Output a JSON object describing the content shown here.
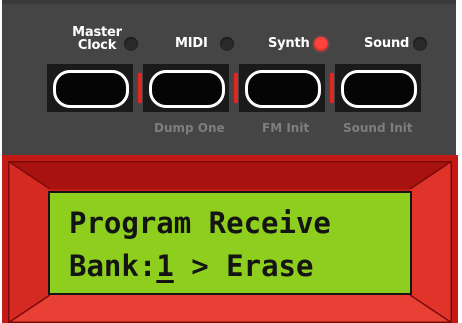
{
  "buttons": [
    {
      "label_line1": "Master",
      "label_line2": "Clock",
      "led_on": false,
      "sub_label": ""
    },
    {
      "label_line1": "MIDI",
      "label_line2": "",
      "led_on": false,
      "sub_label": "Dump One"
    },
    {
      "label_line1": "Synth",
      "label_line2": "",
      "led_on": true,
      "sub_label": "FM Init"
    },
    {
      "label_line1": "Sound",
      "label_line2": "",
      "led_on": false,
      "sub_label": "Sound Init"
    }
  ],
  "display": {
    "line1": "Program Receive",
    "line2_prefix": "Bank:",
    "line2_cursor": "1",
    "line2_suffix": " > Erase"
  },
  "colors": {
    "panel": "#454545",
    "led_on": "#ff4440",
    "led_off": "#2a2a2a",
    "divider_red": "#e3241f",
    "bezel_red": "#c41a15",
    "lcd_green": "#8ece1e",
    "lcd_text": "#141414",
    "sub_label_gray": "#7e7e7e"
  }
}
